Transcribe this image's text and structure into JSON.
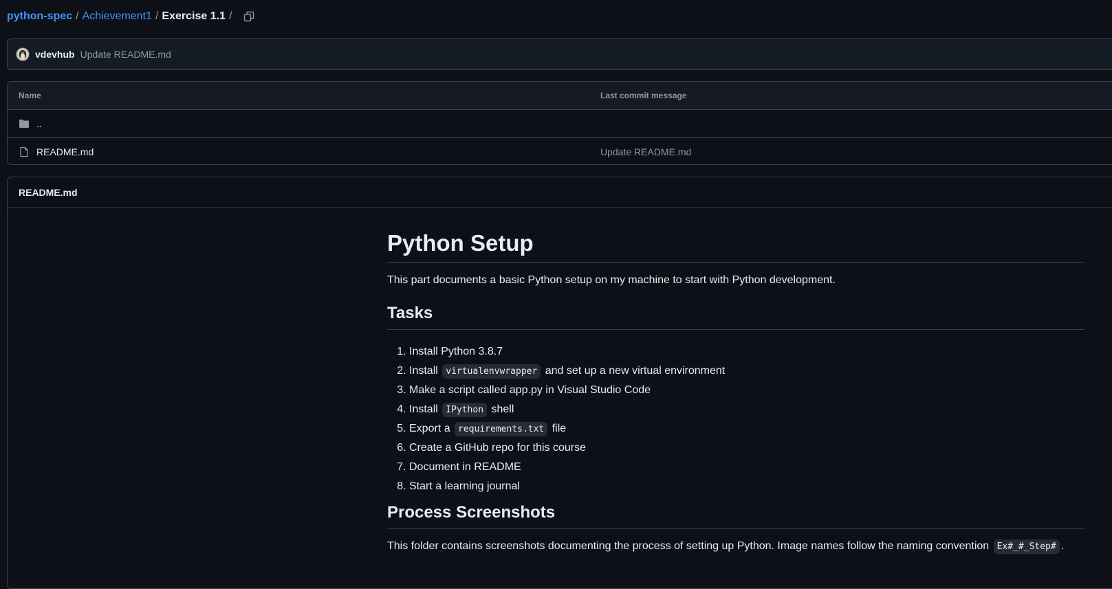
{
  "breadcrumb": {
    "repo": "python-spec",
    "folder": "Achievement1",
    "current": "Exercise 1.1",
    "separator": "/"
  },
  "commit": {
    "author": "vdevhub",
    "message": "Update README.md"
  },
  "files": {
    "header_name": "Name",
    "header_message": "Last commit message",
    "rows": [
      {
        "name": "..",
        "message": "",
        "icon": "folder-icon"
      },
      {
        "name": "README.md",
        "message": "Update README.md",
        "icon": "file-icon"
      }
    ]
  },
  "readme": {
    "title": "README.md",
    "h1": "Python Setup",
    "intro": "This part documents a basic Python setup on my machine to start with Python development.",
    "tasks_heading": "Tasks",
    "tasks": [
      {
        "before": "Install Python 3.8.7",
        "code": "",
        "after": ""
      },
      {
        "before": "Install ",
        "code": "virtualenvwrapper",
        "after": " and set up a new virtual environment"
      },
      {
        "before": "Make a script called app.py in Visual Studio Code",
        "code": "",
        "after": ""
      },
      {
        "before": "Install ",
        "code": "IPython",
        "after": " shell"
      },
      {
        "before": "Export a ",
        "code": "requirements.txt",
        "after": " file"
      },
      {
        "before": "Create a GitHub repo for this course",
        "code": "",
        "after": ""
      },
      {
        "before": "Document in README",
        "code": "",
        "after": ""
      },
      {
        "before": "Start a learning journal",
        "code": "",
        "after": ""
      }
    ],
    "screens_heading": "Process Screenshots",
    "screens_text": "This folder contains screenshots documenting the process of setting up Python. Image names follow the naming convention ",
    "screens_code": "Ex#_#_Step#",
    "screens_end": "."
  },
  "colors": {
    "background": "#0d1117",
    "link": "#4493f8",
    "muted": "#9198a1",
    "border": "#3d444d"
  }
}
